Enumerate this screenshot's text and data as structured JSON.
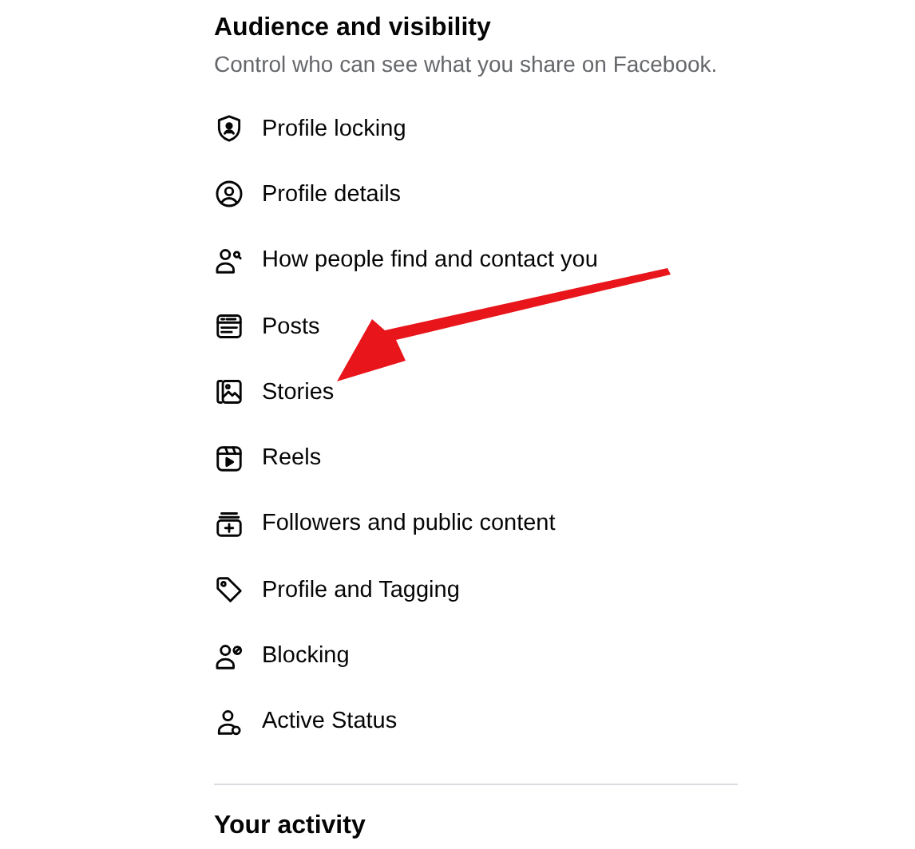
{
  "section": {
    "title": "Audience and visibility",
    "subtitle": "Control who can see what you share on Facebook."
  },
  "items": [
    {
      "label": "Profile locking"
    },
    {
      "label": "Profile details"
    },
    {
      "label": "How people find and contact you"
    },
    {
      "label": "Posts"
    },
    {
      "label": "Stories"
    },
    {
      "label": "Reels"
    },
    {
      "label": "Followers and public content"
    },
    {
      "label": "Profile and Tagging"
    },
    {
      "label": "Blocking"
    },
    {
      "label": "Active Status"
    }
  ],
  "next_section": {
    "title": "Your activity"
  }
}
